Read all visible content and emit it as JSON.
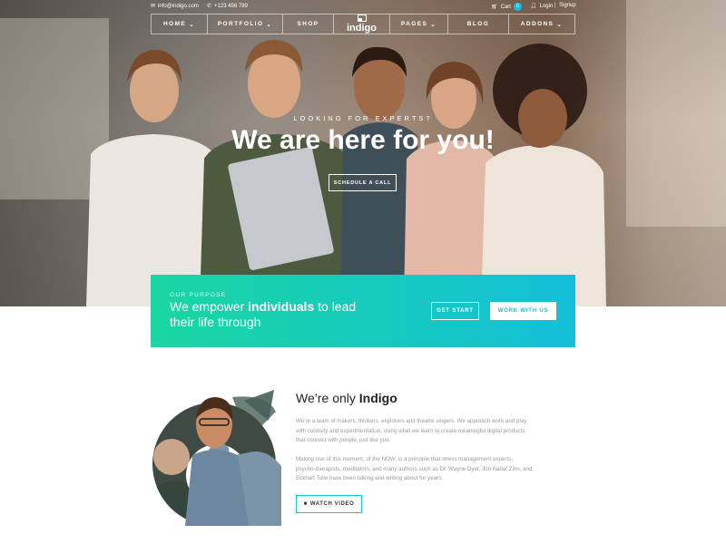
{
  "topbar": {
    "email": "info@indigo.com",
    "phone": "+123 456 789",
    "cart_label": "Cart",
    "cart_count": "0",
    "login": "Login",
    "separator": "|",
    "signup": "Signup"
  },
  "nav": {
    "left": [
      {
        "label": "HOME",
        "dropdown": true
      },
      {
        "label": "PORTFOLIO",
        "dropdown": true
      },
      {
        "label": "SHOP",
        "dropdown": false
      }
    ],
    "logo_text": "indigo",
    "right": [
      {
        "label": "PAGES",
        "dropdown": true
      },
      {
        "label": "BLOG",
        "dropdown": false
      },
      {
        "label": "ADDONS",
        "dropdown": true
      }
    ]
  },
  "hero": {
    "subtitle": "LOOKING FOR EXPERTS?",
    "title": "We are here for you!",
    "button": "SCHEDULE A CALL"
  },
  "purpose": {
    "label": "OUR PURPOSE",
    "text_pre": "We empower ",
    "text_bold": "individuals",
    "text_post": " to lead their life through",
    "btn_start": "GET START",
    "btn_work": "WORK WITH US"
  },
  "about": {
    "title_pre": "We’re only ",
    "title_bold": "Indigo",
    "para1": "We’re a team of makers, thinkers, explorers and theatre singers. We approach work and play with curiosity and experimentation, using what we learn to create meaningful digital products that connect with people, just like you.",
    "para2": "Making use of this moment, of the NOW, is a principle that stress management experts, psycho-therapists, meditators, and many authors such as Dr. Wayne Dyer, Jon Kabat Zinn, and Eckhart Tolle have been talking and writing about for years.",
    "watch_btn": "WATCH VIDEO"
  },
  "colors": {
    "accent_teal": "#16cbbb",
    "accent_green": "#19d6a2",
    "accent_blue": "#14bfd9"
  }
}
